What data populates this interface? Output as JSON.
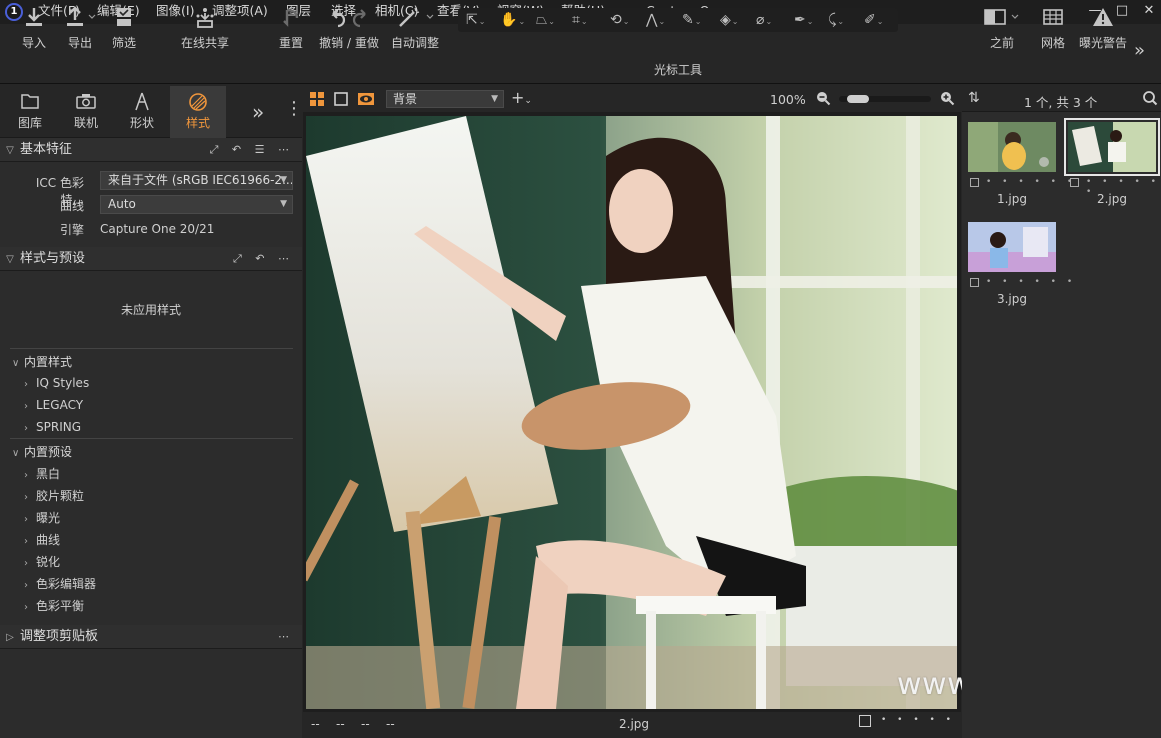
{
  "app": {
    "title": "Capture One",
    "logo": "1"
  },
  "menu": [
    "文件(F)",
    "编辑(E)",
    "图像(I)",
    "调整项(A)",
    "图层",
    "选择",
    "相机(C)",
    "查看(V)",
    "视窗(W)",
    "帮助(H)"
  ],
  "window_controls": {
    "minimize": "—",
    "maximize": "□",
    "close": "✕"
  },
  "toolbar": {
    "import": "导入",
    "export": "导出",
    "filter": "筛选",
    "share": "在线共享",
    "reset": "重置",
    "undo_redo": "撤销 / 重做",
    "auto_adjust": "自动调整",
    "cursor_tools": "光标工具",
    "before": "之前",
    "grid": "网格",
    "exposure_warning": "曝光警告"
  },
  "tool_tabs": [
    {
      "label": "图库",
      "icon": "folder-icon"
    },
    {
      "label": "联机",
      "icon": "camera-icon"
    },
    {
      "label": "形状",
      "icon": "lens-icon"
    },
    {
      "label": "样式",
      "icon": "styles-icon",
      "active": true
    }
  ],
  "basic_characteristics": {
    "title": "基本特征",
    "icc_label": "ICC 色彩特...",
    "icc_value": "来自于文件 (sRGB IEC61966-2...",
    "curve_label": "曲线",
    "curve_value": "Auto",
    "engine_label": "引擎",
    "engine_value": "Capture One 20/21"
  },
  "styles_presets": {
    "title": "样式与预设",
    "no_style": "未应用样式",
    "builtin_styles": "内置样式",
    "style_items": [
      "IQ Styles",
      "LEGACY",
      "SPRING"
    ],
    "builtin_presets": "内置预设",
    "preset_items": [
      "黑白",
      "胶片颗粒",
      "曝光",
      "曲线",
      "锐化",
      "色彩编辑器",
      "色彩平衡"
    ]
  },
  "clipboard": {
    "title": "调整项剪贴板"
  },
  "viewer": {
    "background": "背景",
    "zoom": "100%",
    "zoom_level": 0.12,
    "bottom_meta": [
      "--",
      "--",
      "--",
      "--"
    ],
    "filename": "2.jpg",
    "rating_dots": "• • • • •"
  },
  "browser": {
    "count": "1 个, 共 3 个",
    "thumbnails": [
      {
        "name": "1.jpg",
        "selected": false
      },
      {
        "name": "2.jpg",
        "selected": true
      },
      {
        "name": "3.jpg",
        "selected": false
      }
    ],
    "meta_dots": "• • • • • •"
  },
  "watermark": "www.hunls.com",
  "colors": {
    "accent": "#f0963c",
    "bg": "#262626",
    "panel": "#2c2c2c"
  }
}
